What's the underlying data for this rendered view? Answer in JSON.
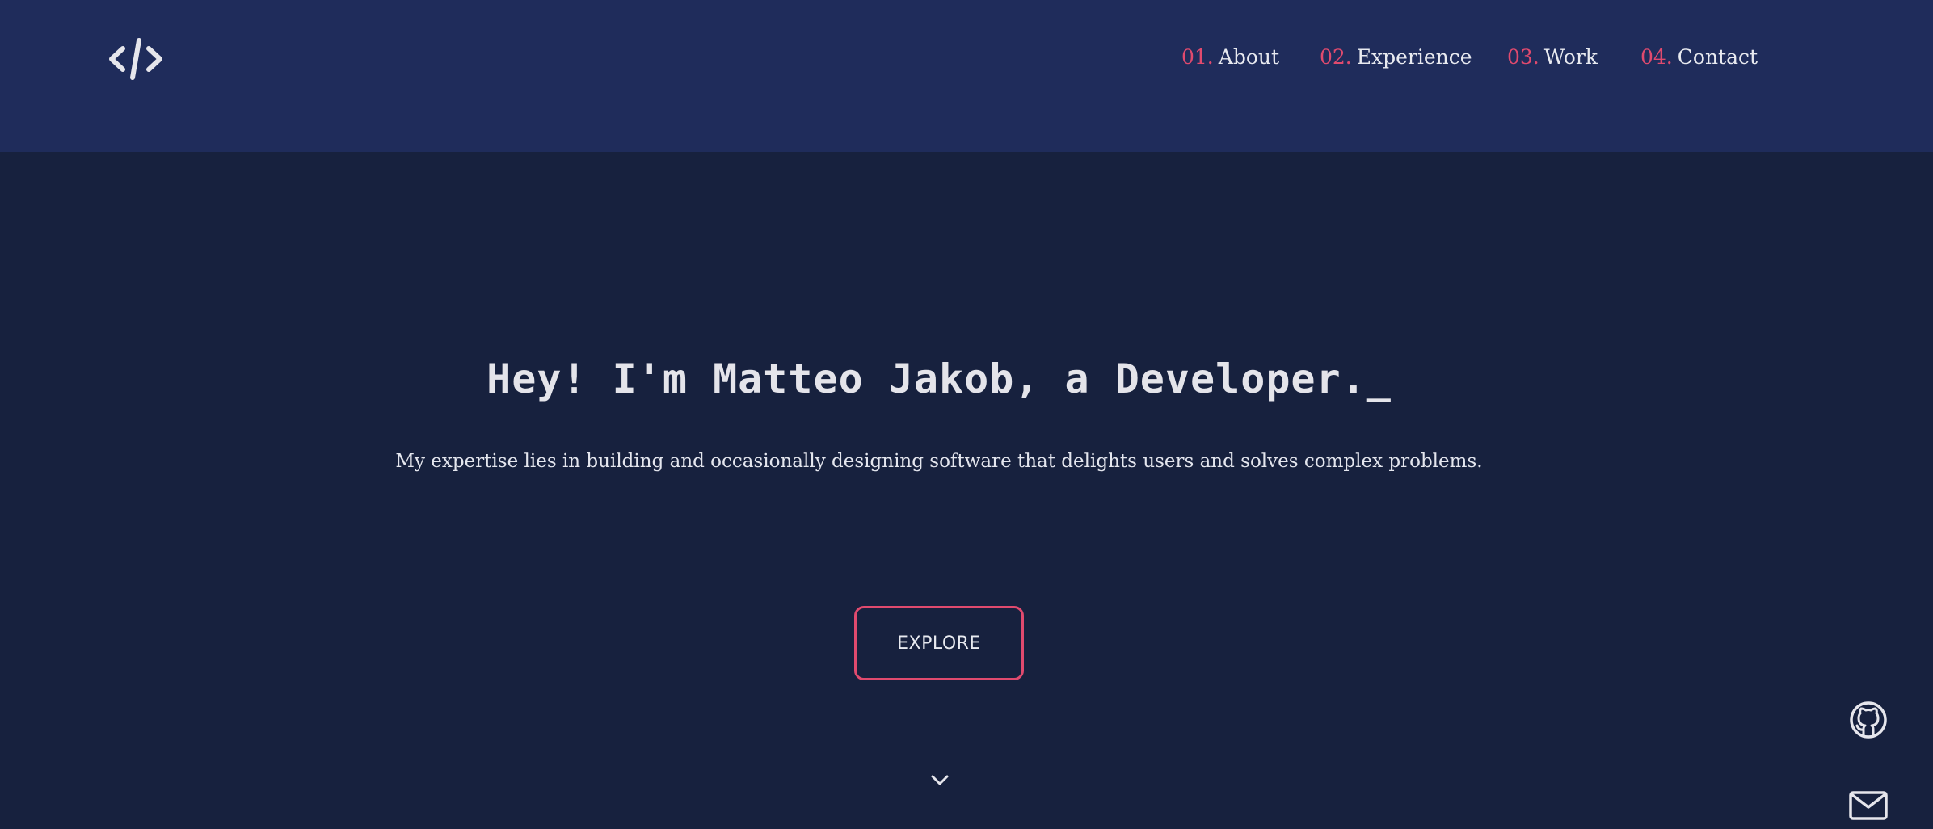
{
  "navbar": {
    "logo_icon": "code-brackets-icon",
    "links": [
      {
        "num": "01.",
        "label": "About"
      },
      {
        "num": "02.",
        "label": "Experience"
      },
      {
        "num": "03.",
        "label": "Work"
      },
      {
        "num": "04.",
        "label": "Contact"
      }
    ]
  },
  "hero": {
    "title": "Hey! I'm Matteo Jakob, a Developer._",
    "subtitle": "My expertise lies in building and occasionally designing software that delights users and solves complex problems.",
    "button_label": "EXPLORE",
    "scroll_icon": "chevron-down-icon"
  },
  "social": {
    "github_icon": "github-icon",
    "mail_icon": "mail-icon"
  },
  "colors": {
    "background": "#17213e",
    "navbar": "#1f2c5b",
    "accent": "#e04a6e",
    "text": "#e6e8ee"
  }
}
